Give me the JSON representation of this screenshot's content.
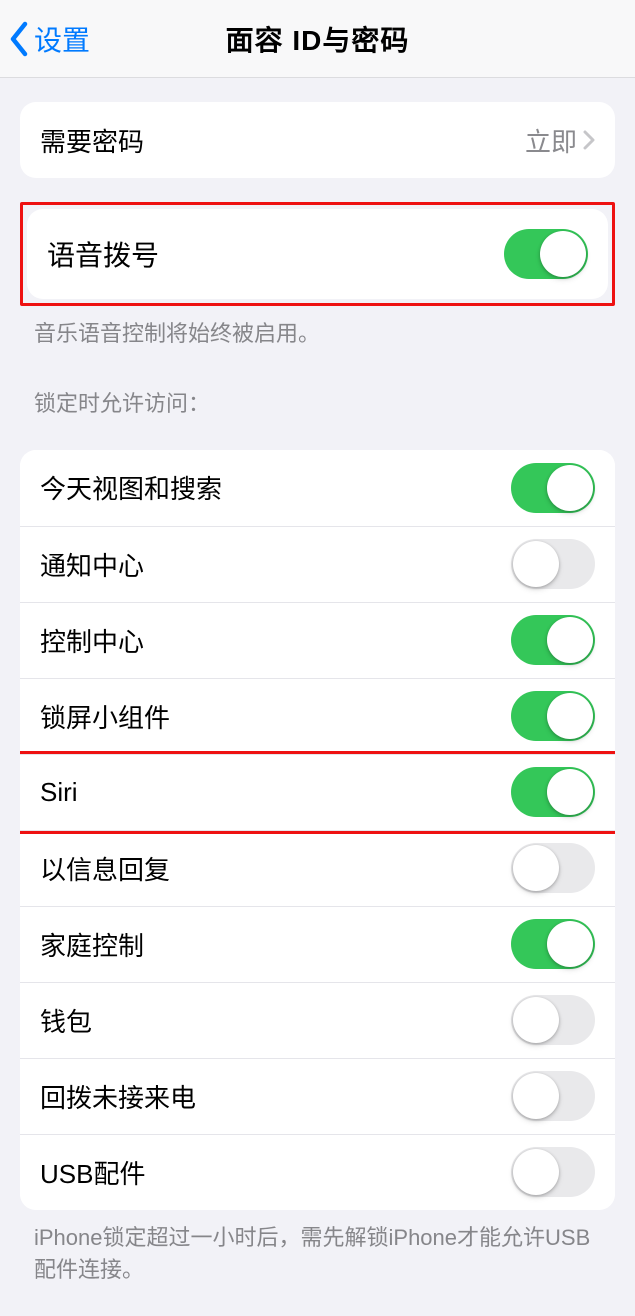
{
  "nav": {
    "back": "设置",
    "title": "面容 ID与密码"
  },
  "require_passcode": {
    "label": "需要密码",
    "value": "立即"
  },
  "voice_dial": {
    "label": "语音拨号",
    "on": true,
    "footer": "音乐语音控制将始终被启用。"
  },
  "lock_access": {
    "header": "锁定时允许访问：",
    "items": [
      {
        "label": "今天视图和搜索",
        "on": true
      },
      {
        "label": "通知中心",
        "on": false
      },
      {
        "label": "控制中心",
        "on": true
      },
      {
        "label": "锁屏小组件",
        "on": true
      },
      {
        "label": "Siri",
        "on": true,
        "highlight": true
      },
      {
        "label": "以信息回复",
        "on": false
      },
      {
        "label": "家庭控制",
        "on": true
      },
      {
        "label": "钱包",
        "on": false
      },
      {
        "label": "回拨未接来电",
        "on": false
      },
      {
        "label": "USB配件",
        "on": false
      }
    ],
    "footer": "iPhone锁定超过一小时后，需先解锁iPhone才能允许USB配件连接。"
  }
}
